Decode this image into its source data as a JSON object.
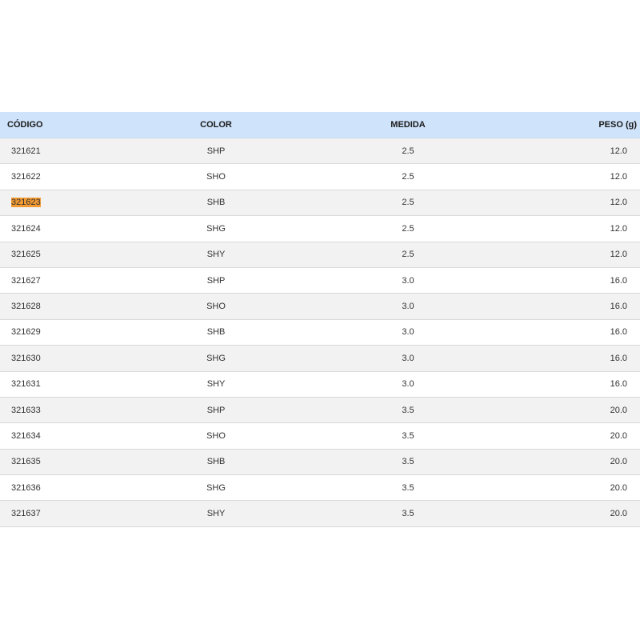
{
  "table": {
    "headers": {
      "code": "CÓDIGO",
      "color": "COLOR",
      "medida": "MEDIDA",
      "peso": "PESO (g)"
    },
    "highlight_color": "#f39a32",
    "rows": [
      {
        "code": "321621",
        "color": "SHP",
        "medida": "2.5",
        "peso": "12.0"
      },
      {
        "code": "321622",
        "color": "SHO",
        "medida": "2.5",
        "peso": "12.0"
      },
      {
        "code": "321623",
        "color": "SHB",
        "medida": "2.5",
        "peso": "12.0",
        "highlighted": true
      },
      {
        "code": "321624",
        "color": "SHG",
        "medida": "2.5",
        "peso": "12.0"
      },
      {
        "code": "321625",
        "color": "SHY",
        "medida": "2.5",
        "peso": "12.0"
      },
      {
        "code": "321627",
        "color": "SHP",
        "medida": "3.0",
        "peso": "16.0"
      },
      {
        "code": "321628",
        "color": "SHO",
        "medida": "3.0",
        "peso": "16.0"
      },
      {
        "code": "321629",
        "color": "SHB",
        "medida": "3.0",
        "peso": "16.0"
      },
      {
        "code": "321630",
        "color": "SHG",
        "medida": "3.0",
        "peso": "16.0"
      },
      {
        "code": "321631",
        "color": "SHY",
        "medida": "3.0",
        "peso": "16.0"
      },
      {
        "code": "321633",
        "color": "SHP",
        "medida": "3.5",
        "peso": "20.0"
      },
      {
        "code": "321634",
        "color": "SHO",
        "medida": "3.5",
        "peso": "20.0"
      },
      {
        "code": "321635",
        "color": "SHB",
        "medida": "3.5",
        "peso": "20.0"
      },
      {
        "code": "321636",
        "color": "SHG",
        "medida": "3.5",
        "peso": "20.0"
      },
      {
        "code": "321637",
        "color": "SHY",
        "medida": "3.5",
        "peso": "20.0"
      }
    ]
  }
}
